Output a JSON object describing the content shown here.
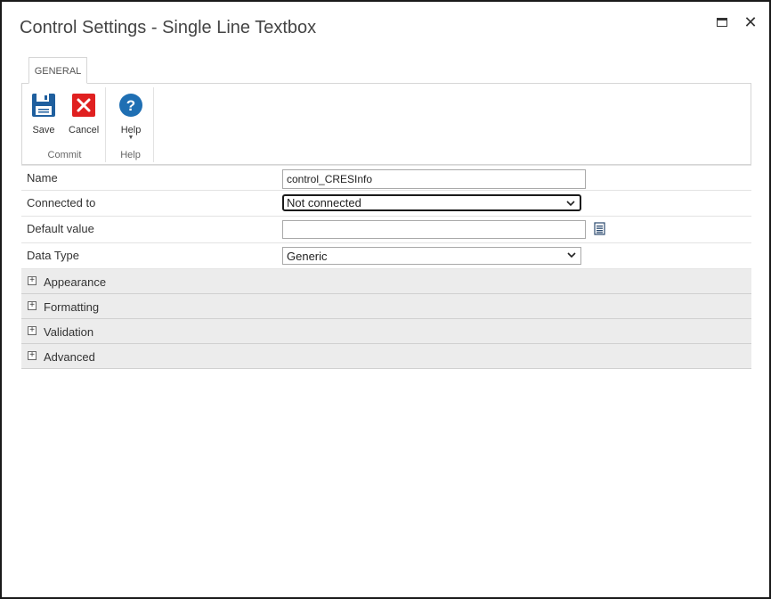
{
  "window": {
    "title": "Control Settings - Single Line Textbox",
    "maximize_icon": "maximize-icon",
    "close_icon": "close-icon"
  },
  "tabs": [
    {
      "label": "GENERAL"
    }
  ],
  "ribbon": {
    "groups": [
      {
        "label": "Commit",
        "buttons": [
          {
            "label": "Save",
            "icon": "save-icon"
          },
          {
            "label": "Cancel",
            "icon": "cancel-icon"
          }
        ]
      },
      {
        "label": "Help",
        "buttons": [
          {
            "label": "Help",
            "icon": "help-icon"
          }
        ]
      }
    ],
    "colors": {
      "save": "#1f5f9e",
      "cancel": "#e02020",
      "help": "#1f6fb3"
    }
  },
  "properties": [
    {
      "label": "Name",
      "value": "control_CRESInfo"
    },
    {
      "label": "Connected to",
      "value": "Not connected"
    },
    {
      "label": "Default value",
      "value": ""
    },
    {
      "label": "Data Type",
      "value": "Generic"
    }
  ],
  "sections": [
    {
      "label": "Appearance"
    },
    {
      "label": "Formatting"
    },
    {
      "label": "Validation"
    },
    {
      "label": "Advanced"
    }
  ]
}
